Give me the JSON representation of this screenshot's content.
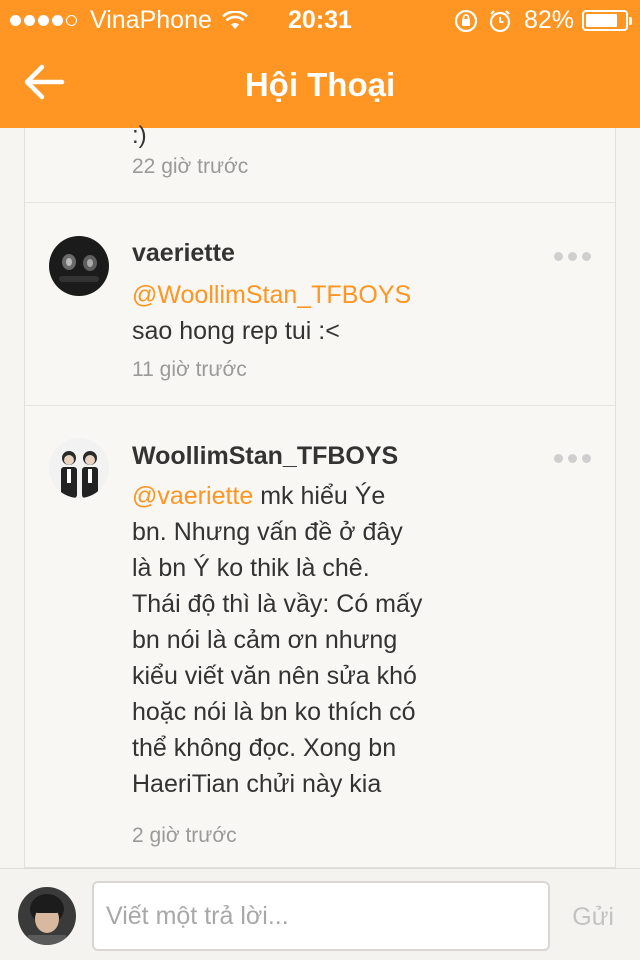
{
  "status_bar": {
    "carrier": "VinaPhone",
    "time": "20:31",
    "battery": "82%",
    "battery_level": 0.82,
    "icons": [
      "signal-dots",
      "wifi-icon",
      "rotation-lock-icon",
      "alarm-icon",
      "battery-icon"
    ]
  },
  "header": {
    "title": "Hội Thoại",
    "back_icon": "arrow-left-icon"
  },
  "colors": {
    "accent": "#ff9522",
    "text": "#333333",
    "muted": "#9a9a9a"
  },
  "conversation": {
    "fragment": {
      "text": ":)",
      "time": "22 giờ trước"
    },
    "comments": [
      {
        "username": "vaeriette",
        "mention": "@WoollimStan_TFBOYS",
        "text": "sao hong rep tui :<",
        "time": "11 giờ trước"
      },
      {
        "username": "WoollimStan_TFBOYS",
        "mention": "@vaeriette",
        "text_lines": [
          "mk hiểu Ýe",
          "bn. Nhưng vấn đề ở đây",
          "là bn Ý ko thik là chê.",
          "Thái độ thì là vầy: Có mấy",
          "bn nói là cảm ơn nhưng",
          "kiểu viết văn nên sửa khó",
          "hoặc nói là bn ko thích có",
          "thể không đọc. Xong bn",
          "HaeriTian chửi này kia"
        ],
        "time": "2 giờ trước"
      }
    ]
  },
  "reply": {
    "placeholder": "Viết một trả lời...",
    "value": "",
    "send_label": "Gửi"
  }
}
